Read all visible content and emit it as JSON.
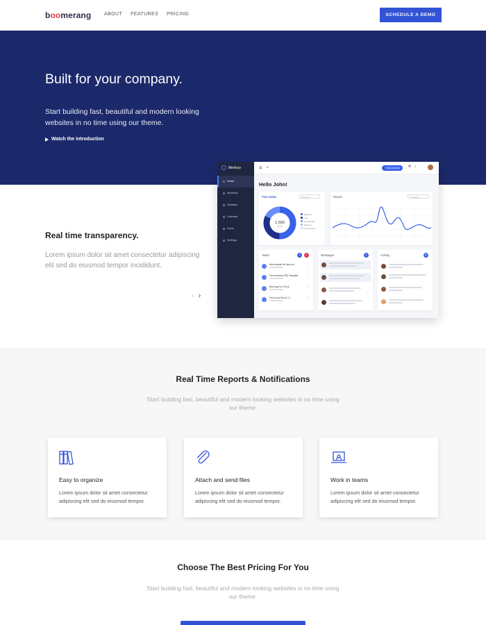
{
  "nav": {
    "logo_prefix": "b",
    "logo_oo": "oo",
    "logo_suffix": "merang",
    "links": [
      "ABOUT",
      "FEATURES",
      "PRICING"
    ],
    "cta": "SCHEDULE A DEMO"
  },
  "hero": {
    "title": "Built for your company.",
    "subtitle": "Start building fast, beautiful and modern looking websites in no time using our theme.",
    "link": "Watch the introduction"
  },
  "transparency": {
    "title": "Real time transparency.",
    "text": "Lorem ipsum dolor sit amet consectetur adipiscing elit sed do eiusmod tempor incididunt.",
    "prev_arrow": "‹",
    "next_arrow": "›"
  },
  "dashboard": {
    "brand": "Merkury",
    "sidebar": [
      "Home",
      "Workflow",
      "Statistics",
      "Calendar",
      "Users",
      "Settings"
    ],
    "add_button": "+ Add product",
    "greeting": "Hello John!",
    "sales": {
      "title": "Your Sales",
      "select": "This year ▾",
      "donut_value": "1,560",
      "donut_label": "Sales",
      "legend": [
        "Websites",
        "Logo",
        "Social Media",
        "Adwords",
        "E-Commerce"
      ]
    },
    "report": {
      "title": "Report",
      "select": "This year ▾"
    },
    "tasks": {
      "title": "Tasks",
      "badges": [
        "4",
        "2"
      ],
      "items": [
        "New website for Symu.co",
        "Free business PSD Template",
        "New logo for JCD.pl",
        "Free Icons Set vol. 3"
      ]
    },
    "messages": {
      "title": "Messages",
      "badge": "2"
    },
    "activity": {
      "title": "Activity",
      "badge": "10"
    }
  },
  "features": {
    "title": "Real Time Reports & Notifications",
    "subtitle": "Start building fast, beautiful and modern looking websites in no time using our theme.",
    "cards": [
      {
        "icon": "books-icon",
        "title": "Easy to organize",
        "text": "Lorem ipsum dolor sit amet consectetur adipiscing elit sed do eiusmod tempor."
      },
      {
        "icon": "paperclip-icon",
        "title": "Attach and send files",
        "text": "Lorem ipsum dolor sit amet consectetur adipiscing elit sed do eiusmod tempor."
      },
      {
        "icon": "laptop-icon",
        "title": "Work in teams",
        "text": "Lorem ipsum dolor sit amet consectetur adipiscing elit sed do eiusmod tempor."
      }
    ]
  },
  "pricing": {
    "title": "Choose The Best Pricing For You",
    "subtitle": "Start building fast, beautiful and modern looking websites in no time using our theme."
  },
  "colors": {
    "primary": "#3353d6",
    "hero_bg": "#1b296b",
    "logo_accent": "#e2384d",
    "dash_sidebar": "#1f2640"
  }
}
